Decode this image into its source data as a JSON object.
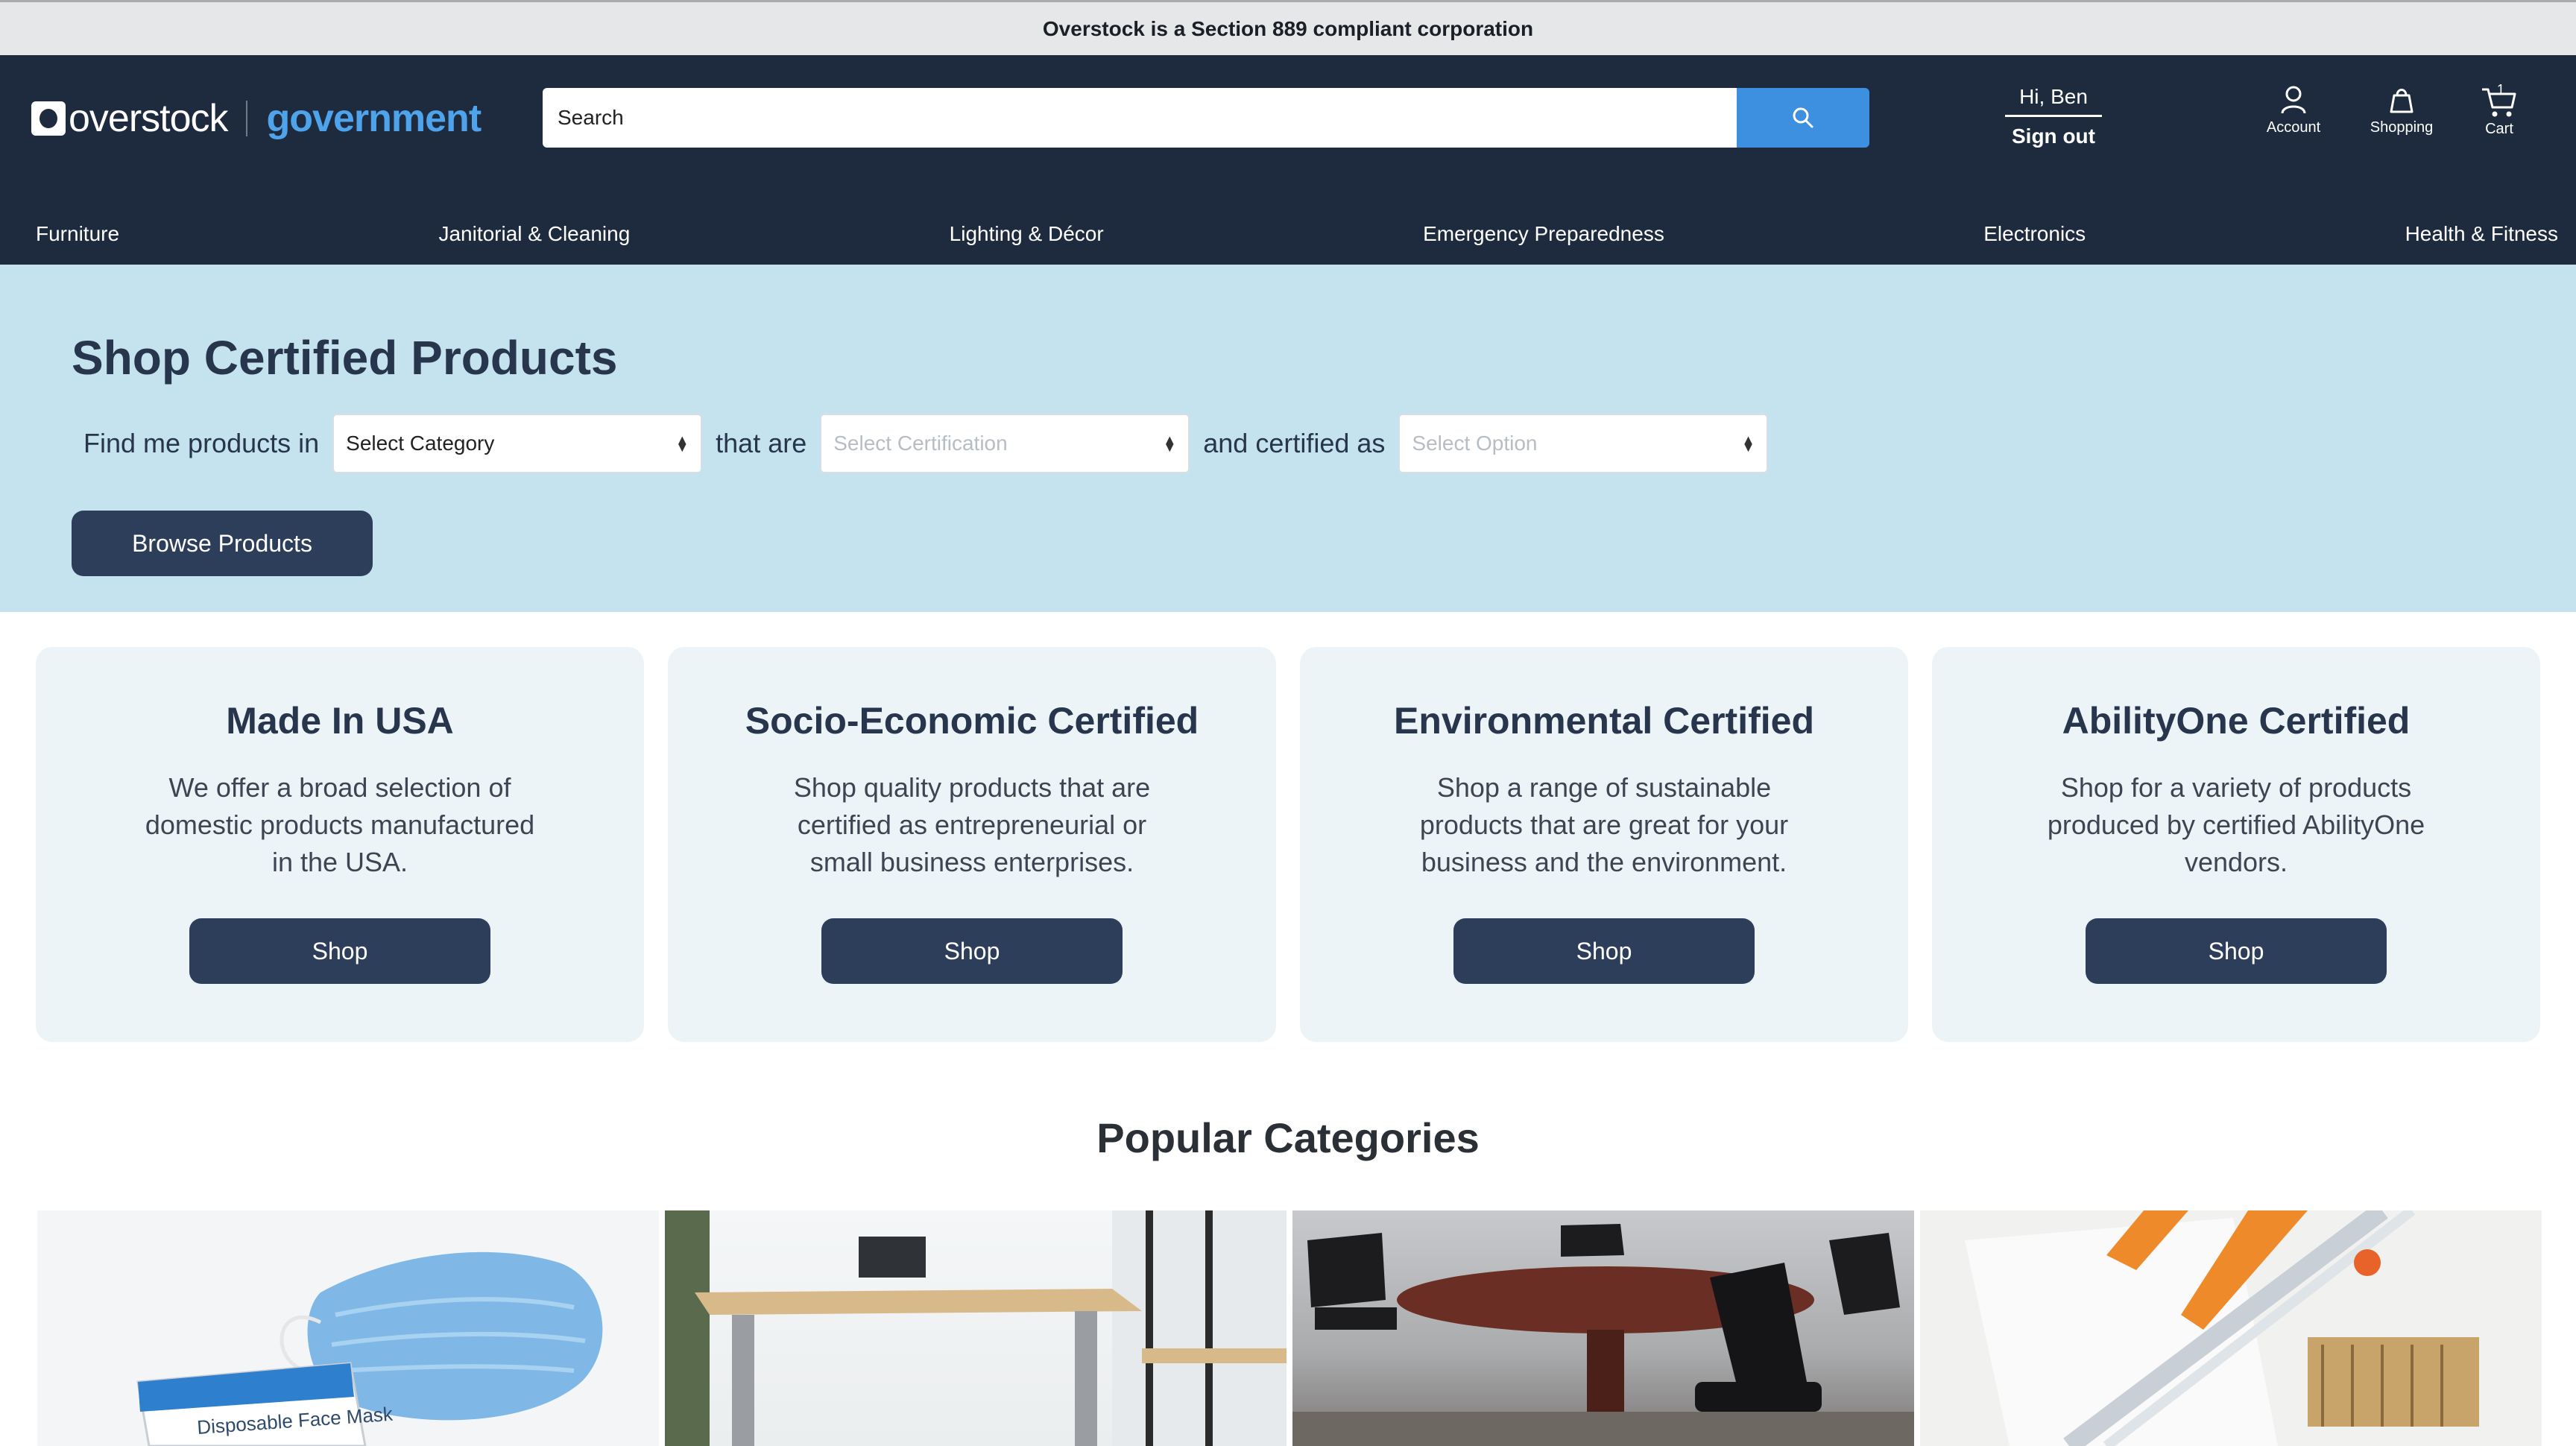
{
  "banner": {
    "text": "Overstock is a Section 889 compliant corporation"
  },
  "header": {
    "logo_word": "overstock",
    "logo_sub": "government",
    "search_placeholder": "Search",
    "greeting": "Hi, Ben",
    "sign_out": "Sign out",
    "account_label": "Account",
    "shopping_label": "Shopping",
    "cart_label": "Cart",
    "cart_count": "1"
  },
  "nav": [
    "Furniture",
    "Janitorial & Cleaning",
    "Lighting & Décor",
    "Emergency Preparedness",
    "Electronics",
    "Health & Fitness"
  ],
  "hero": {
    "title": "Shop Certified Products",
    "find_text": "Find me products in",
    "category_value": "Select Category",
    "that_are": "that are",
    "certification_placeholder": "Select Certification",
    "certified_as": "and certified as",
    "option_placeholder": "Select Option",
    "browse_label": "Browse Products"
  },
  "cards": [
    {
      "title": "Made In USA",
      "desc": "We offer a broad selection of domestic products manufactured in the USA.",
      "button": "Shop"
    },
    {
      "title": "Socio-Economic Certified",
      "desc": "Shop quality products that are certified as entrepreneurial or small business enterprises.",
      "button": "Shop"
    },
    {
      "title": "Environmental Certified",
      "desc": "Shop a range of sustainable products that are great for your business and the environment.",
      "button": "Shop"
    },
    {
      "title": "AbilityOne Certified",
      "desc": "Shop for a variety of products produced by certified AbilityOne vendors.",
      "button": "Shop"
    }
  ],
  "popular": {
    "title": "Popular Categories",
    "box_text": "Disposable Face Mask"
  },
  "colors": {
    "header_bg": "#1e2a3d",
    "hero_bg": "#c5e3ef",
    "accent_blue": "#3d8fe0",
    "button_navy": "#2d3e5b",
    "card_bg": "#edf4f8"
  }
}
